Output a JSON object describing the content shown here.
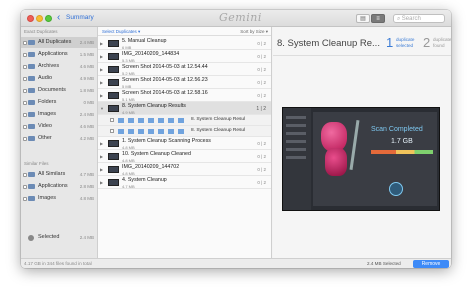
{
  "titlebar": {
    "back": "‹",
    "breadcrumb": "Summary",
    "app_logo": "Gemini",
    "search_placeholder": "Search"
  },
  "sidebar": {
    "section_exact": "Exact Duplicates",
    "exact_items": [
      {
        "label": "All Duplicates",
        "size": "2.4 MB"
      },
      {
        "label": "Applications",
        "size": "1.5 MB"
      },
      {
        "label": "Archives",
        "size": "4.6 MB"
      },
      {
        "label": "Audio",
        "size": "4.9 MB"
      },
      {
        "label": "Documents",
        "size": "1.8 MB"
      },
      {
        "label": "Folders",
        "size": "0 MB"
      },
      {
        "label": "Images",
        "size": "2.4 MB"
      },
      {
        "label": "Video",
        "size": "4.6 MB"
      },
      {
        "label": "Other",
        "size": "4.2 MB"
      }
    ],
    "section_similar": "Similar Files",
    "similar_items": [
      {
        "label": "All Similars",
        "size": "4.7 MB"
      },
      {
        "label": "Applications",
        "size": "2.8 MB"
      },
      {
        "label": "Images",
        "size": "4.8 MB"
      }
    ],
    "selected_label": "Selected",
    "selected_size": "2.4 MB"
  },
  "list": {
    "header_left": "Select Duplicates ▾",
    "header_right": "Sort by Size ▾",
    "rows": [
      {
        "name": "5. Manual Cleanup",
        "size": "6 MB",
        "count": "0 | 2"
      },
      {
        "name": "IMG_20140209_144834",
        "size": "5.3 MB",
        "count": "0 | 2"
      },
      {
        "name": "Screen Shot 2014-05-03 at 12.54.44",
        "size": "5.2 MB",
        "count": "0 | 2"
      },
      {
        "name": "Screen Shot 2014-05-03 at 12.56.23",
        "size": "5 MB",
        "count": "0 | 2"
      },
      {
        "name": "Screen Shot 2014-05-03 at 12.58.16",
        "size": "5.1 MB",
        "count": "0 | 2"
      },
      {
        "name": "8. System Cleanup Results",
        "size": "4.9 MB",
        "count": "1 | 2"
      },
      {
        "name": "1. System Cleanup Scanning Process",
        "size": "4.8 MB",
        "count": "0 | 2"
      },
      {
        "name": "10. System Cleanup Cleaned",
        "size": "4.8 MB",
        "count": "0 | 2"
      },
      {
        "name": "IMG_20140209_144702",
        "size": "4.8 MB",
        "count": "0 | 2"
      },
      {
        "name": "4. System Cleanup",
        "size": "4.7 MB",
        "count": "0 | 2"
      }
    ],
    "sub_rows": [
      {
        "name": "8. System Cleanup Resul"
      },
      {
        "name": "8. System Cleanup Resul"
      }
    ]
  },
  "preview": {
    "title": "8. System Cleanup Re...",
    "selected_count": "1",
    "selected_label_1": "duplicate",
    "selected_label_2": "selected",
    "found_count": "2",
    "found_label_1": "duplicates",
    "found_label_2": "found",
    "shot_heading": "Scan Completed",
    "shot_value": "1.7 GB"
  },
  "status": {
    "left": "4.17 GB in 344 files found in total",
    "selected": "2.4 MB Selected",
    "remove": "Remove"
  }
}
